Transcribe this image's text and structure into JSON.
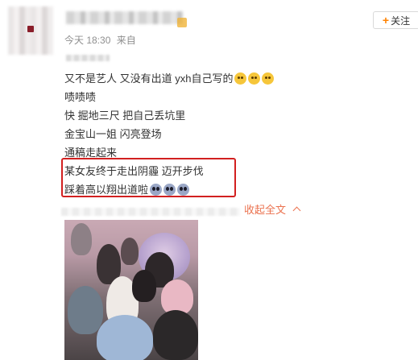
{
  "header": {
    "meta_time": "今天 18:30",
    "meta_source": "来自"
  },
  "follow_button": {
    "label": "关注"
  },
  "post": {
    "lines": [
      "又不是艺人 又没有出道 yxh自己写的",
      "啧啧啧",
      "快 掘地三尺 把自己丢坑里",
      "金宝山一姐 闪亮登场",
      "通稿走起来",
      "某女友终于走出阴霾 迈开步伐",
      "踩着高以翔出道啦"
    ],
    "collapse_label": "收起全文"
  },
  "colors": {
    "accent_orange": "#ff8200",
    "link_orange": "#eb7350",
    "highlight_red": "#d22020",
    "meta_gray": "#8f8f8f"
  },
  "icons": {
    "emoji_line1": "cat-face-emoji",
    "emoji_line7": "scared-face-emoji",
    "collapse": "chevron-up-icon",
    "follow": "plus-icon"
  }
}
